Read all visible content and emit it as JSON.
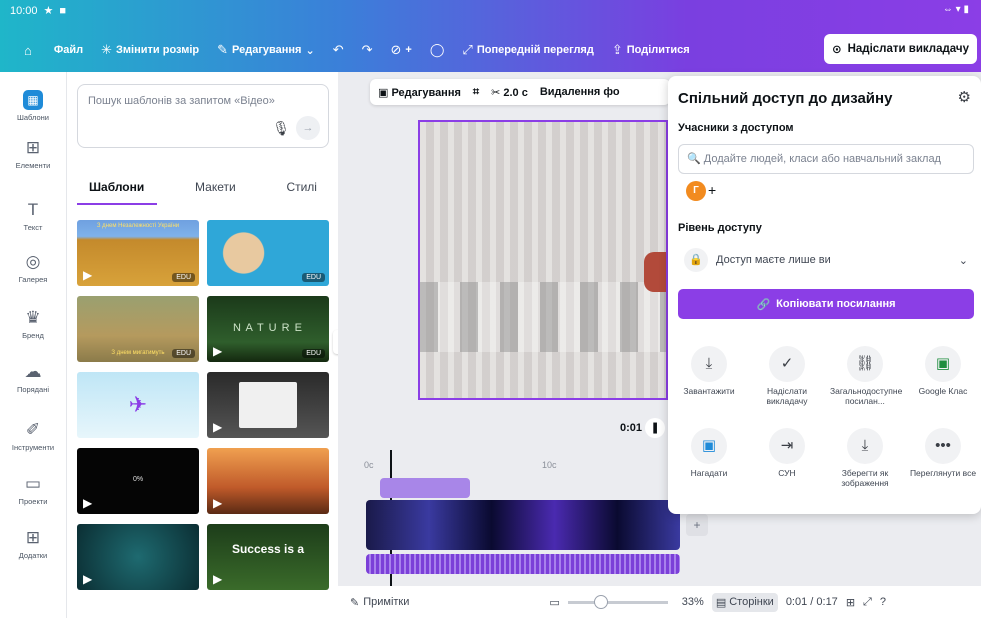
{
  "status_bar": {
    "time": "10:00"
  },
  "menu": {
    "home_icon": "home-icon",
    "file": "Файл",
    "resize": "Змінити розмір",
    "edit": "Редагування",
    "preview": "Попередній перегляд",
    "share": "Поділитися",
    "send_teacher": "Надіслати викладачу"
  },
  "rail": [
    {
      "label": "Шаблони",
      "icon": "templates-icon"
    },
    {
      "label": "Елементи",
      "icon": "elements-icon"
    },
    {
      "label": "Текст",
      "icon": "text-icon"
    },
    {
      "label": "Галерея",
      "icon": "gallery-icon"
    },
    {
      "label": "Бренд",
      "icon": "brand-icon"
    },
    {
      "label": "Порядані",
      "icon": "upload-icon"
    },
    {
      "label": "Інструменти",
      "icon": "tools-icon"
    },
    {
      "label": "Проекти",
      "icon": "projects-icon"
    },
    {
      "label": "Додатки",
      "icon": "apps-icon"
    }
  ],
  "panel": {
    "search_placeholder": "Пошук шаблонів за запитом «Відео»",
    "tabs": [
      "Шаблони",
      "Макети",
      "Стилі"
    ],
    "thumb_labels": {
      "nature": "N A T U R E",
      "success": "Success is a",
      "wheat_caption": "З днем Незалежності України",
      "field_caption": "З днем мигатимуть",
      "percent": "0%",
      "edu": "EDU"
    }
  },
  "toolbar": {
    "edit": "Редагування",
    "duration": "2.0 с",
    "remove_bg": "Видалення фо"
  },
  "canvas": {
    "time": "0:01"
  },
  "timeline": {
    "tick_0": "0с",
    "tick_10": "10с"
  },
  "bottom": {
    "notes": "Примітки",
    "zoom": "33%",
    "pages": "Сторінки",
    "time": "0:01 / 0:17"
  },
  "share_panel": {
    "title": "Спільний доступ до дизайну",
    "members_label": "Учасники з доступом",
    "people_placeholder": "Додайте людей, класи або навчальний заклад",
    "avatar_letter": "Г",
    "access_label": "Рівень доступу",
    "access_value": "Доступ маєте лише ви",
    "copy_link": "Копіювати посилання",
    "options": [
      {
        "label": "Завантажити",
        "icon": "download-icon"
      },
      {
        "label": "Надіслати викладачу",
        "icon": "check-circle-icon"
      },
      {
        "label": "Загальнодоступне посилан...",
        "icon": "link-icon"
      },
      {
        "label": "Google Клас",
        "icon": "google-classroom-icon"
      },
      {
        "label": "Нагадати",
        "icon": "reminder-icon"
      },
      {
        "label": "СУН",
        "icon": "lms-icon"
      },
      {
        "label": "Зберегти як зображення",
        "icon": "save-image-icon"
      },
      {
        "label": "Переглянути все",
        "icon": "more-icon"
      }
    ]
  },
  "colors": {
    "accent": "#8b3ee6",
    "brand_teal": "#1fb6c9",
    "avatar": "#f28b1f"
  }
}
